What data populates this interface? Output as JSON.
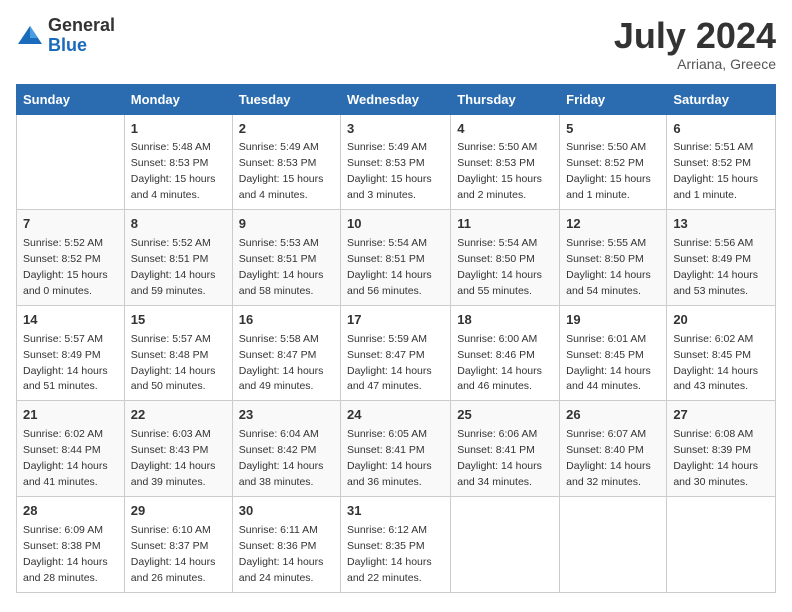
{
  "logo": {
    "general": "General",
    "blue": "Blue"
  },
  "header": {
    "month_year": "July 2024",
    "location": "Arriana, Greece"
  },
  "days_of_week": [
    "Sunday",
    "Monday",
    "Tuesday",
    "Wednesday",
    "Thursday",
    "Friday",
    "Saturday"
  ],
  "weeks": [
    [
      {
        "day": "",
        "sunrise": "",
        "sunset": "",
        "daylight": ""
      },
      {
        "day": "1",
        "sunrise": "Sunrise: 5:48 AM",
        "sunset": "Sunset: 8:53 PM",
        "daylight": "Daylight: 15 hours and 4 minutes."
      },
      {
        "day": "2",
        "sunrise": "Sunrise: 5:49 AM",
        "sunset": "Sunset: 8:53 PM",
        "daylight": "Daylight: 15 hours and 4 minutes."
      },
      {
        "day": "3",
        "sunrise": "Sunrise: 5:49 AM",
        "sunset": "Sunset: 8:53 PM",
        "daylight": "Daylight: 15 hours and 3 minutes."
      },
      {
        "day": "4",
        "sunrise": "Sunrise: 5:50 AM",
        "sunset": "Sunset: 8:53 PM",
        "daylight": "Daylight: 15 hours and 2 minutes."
      },
      {
        "day": "5",
        "sunrise": "Sunrise: 5:50 AM",
        "sunset": "Sunset: 8:52 PM",
        "daylight": "Daylight: 15 hours and 1 minute."
      },
      {
        "day": "6",
        "sunrise": "Sunrise: 5:51 AM",
        "sunset": "Sunset: 8:52 PM",
        "daylight": "Daylight: 15 hours and 1 minute."
      }
    ],
    [
      {
        "day": "7",
        "sunrise": "Sunrise: 5:52 AM",
        "sunset": "Sunset: 8:52 PM",
        "daylight": "Daylight: 15 hours and 0 minutes."
      },
      {
        "day": "8",
        "sunrise": "Sunrise: 5:52 AM",
        "sunset": "Sunset: 8:51 PM",
        "daylight": "Daylight: 14 hours and 59 minutes."
      },
      {
        "day": "9",
        "sunrise": "Sunrise: 5:53 AM",
        "sunset": "Sunset: 8:51 PM",
        "daylight": "Daylight: 14 hours and 58 minutes."
      },
      {
        "day": "10",
        "sunrise": "Sunrise: 5:54 AM",
        "sunset": "Sunset: 8:51 PM",
        "daylight": "Daylight: 14 hours and 56 minutes."
      },
      {
        "day": "11",
        "sunrise": "Sunrise: 5:54 AM",
        "sunset": "Sunset: 8:50 PM",
        "daylight": "Daylight: 14 hours and 55 minutes."
      },
      {
        "day": "12",
        "sunrise": "Sunrise: 5:55 AM",
        "sunset": "Sunset: 8:50 PM",
        "daylight": "Daylight: 14 hours and 54 minutes."
      },
      {
        "day": "13",
        "sunrise": "Sunrise: 5:56 AM",
        "sunset": "Sunset: 8:49 PM",
        "daylight": "Daylight: 14 hours and 53 minutes."
      }
    ],
    [
      {
        "day": "14",
        "sunrise": "Sunrise: 5:57 AM",
        "sunset": "Sunset: 8:49 PM",
        "daylight": "Daylight: 14 hours and 51 minutes."
      },
      {
        "day": "15",
        "sunrise": "Sunrise: 5:57 AM",
        "sunset": "Sunset: 8:48 PM",
        "daylight": "Daylight: 14 hours and 50 minutes."
      },
      {
        "day": "16",
        "sunrise": "Sunrise: 5:58 AM",
        "sunset": "Sunset: 8:47 PM",
        "daylight": "Daylight: 14 hours and 49 minutes."
      },
      {
        "day": "17",
        "sunrise": "Sunrise: 5:59 AM",
        "sunset": "Sunset: 8:47 PM",
        "daylight": "Daylight: 14 hours and 47 minutes."
      },
      {
        "day": "18",
        "sunrise": "Sunrise: 6:00 AM",
        "sunset": "Sunset: 8:46 PM",
        "daylight": "Daylight: 14 hours and 46 minutes."
      },
      {
        "day": "19",
        "sunrise": "Sunrise: 6:01 AM",
        "sunset": "Sunset: 8:45 PM",
        "daylight": "Daylight: 14 hours and 44 minutes."
      },
      {
        "day": "20",
        "sunrise": "Sunrise: 6:02 AM",
        "sunset": "Sunset: 8:45 PM",
        "daylight": "Daylight: 14 hours and 43 minutes."
      }
    ],
    [
      {
        "day": "21",
        "sunrise": "Sunrise: 6:02 AM",
        "sunset": "Sunset: 8:44 PM",
        "daylight": "Daylight: 14 hours and 41 minutes."
      },
      {
        "day": "22",
        "sunrise": "Sunrise: 6:03 AM",
        "sunset": "Sunset: 8:43 PM",
        "daylight": "Daylight: 14 hours and 39 minutes."
      },
      {
        "day": "23",
        "sunrise": "Sunrise: 6:04 AM",
        "sunset": "Sunset: 8:42 PM",
        "daylight": "Daylight: 14 hours and 38 minutes."
      },
      {
        "day": "24",
        "sunrise": "Sunrise: 6:05 AM",
        "sunset": "Sunset: 8:41 PM",
        "daylight": "Daylight: 14 hours and 36 minutes."
      },
      {
        "day": "25",
        "sunrise": "Sunrise: 6:06 AM",
        "sunset": "Sunset: 8:41 PM",
        "daylight": "Daylight: 14 hours and 34 minutes."
      },
      {
        "day": "26",
        "sunrise": "Sunrise: 6:07 AM",
        "sunset": "Sunset: 8:40 PM",
        "daylight": "Daylight: 14 hours and 32 minutes."
      },
      {
        "day": "27",
        "sunrise": "Sunrise: 6:08 AM",
        "sunset": "Sunset: 8:39 PM",
        "daylight": "Daylight: 14 hours and 30 minutes."
      }
    ],
    [
      {
        "day": "28",
        "sunrise": "Sunrise: 6:09 AM",
        "sunset": "Sunset: 8:38 PM",
        "daylight": "Daylight: 14 hours and 28 minutes."
      },
      {
        "day": "29",
        "sunrise": "Sunrise: 6:10 AM",
        "sunset": "Sunset: 8:37 PM",
        "daylight": "Daylight: 14 hours and 26 minutes."
      },
      {
        "day": "30",
        "sunrise": "Sunrise: 6:11 AM",
        "sunset": "Sunset: 8:36 PM",
        "daylight": "Daylight: 14 hours and 24 minutes."
      },
      {
        "day": "31",
        "sunrise": "Sunrise: 6:12 AM",
        "sunset": "Sunset: 8:35 PM",
        "daylight": "Daylight: 14 hours and 22 minutes."
      },
      {
        "day": "",
        "sunrise": "",
        "sunset": "",
        "daylight": ""
      },
      {
        "day": "",
        "sunrise": "",
        "sunset": "",
        "daylight": ""
      },
      {
        "day": "",
        "sunrise": "",
        "sunset": "",
        "daylight": ""
      }
    ]
  ]
}
